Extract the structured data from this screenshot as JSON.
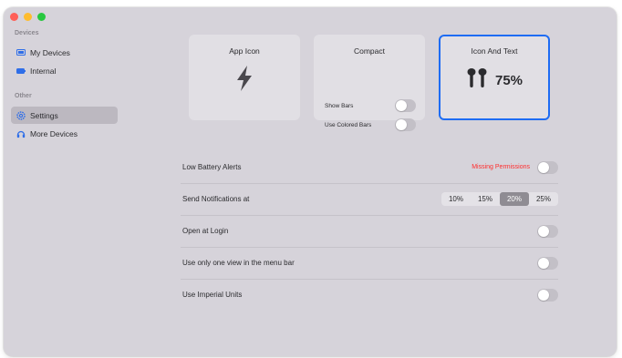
{
  "sidebar": {
    "sections": [
      {
        "title": "Devices",
        "items": [
          {
            "label": "My Devices",
            "icon": "display-icon",
            "selected": false
          },
          {
            "label": "Internal",
            "icon": "battery-icon",
            "selected": false
          }
        ]
      },
      {
        "title": "Other",
        "items": [
          {
            "label": "Settings",
            "icon": "gear-icon",
            "selected": true
          },
          {
            "label": "More Devices",
            "icon": "headphones-icon",
            "selected": false
          }
        ]
      }
    ]
  },
  "styles": {
    "cards": [
      {
        "title": "App Icon",
        "icon": "lightning-bolt-icon",
        "selected": false
      },
      {
        "title": "Compact",
        "selected": false,
        "options": [
          {
            "label": "Show Bars",
            "on": false
          },
          {
            "label": "Use Colored Bars",
            "on": false
          }
        ]
      },
      {
        "title": "Icon And Text",
        "icon": "airpods-icon",
        "value": "75%",
        "selected": true
      }
    ]
  },
  "settings": {
    "low_battery": {
      "label": "Low Battery Alerts",
      "warning": "Missing Permissions",
      "on": false
    },
    "notifications": {
      "label": "Send Notifications at",
      "options": [
        "10%",
        "15%",
        "20%",
        "25%"
      ],
      "selected": "20%"
    },
    "open_at_login": {
      "label": "Open at Login",
      "on": false
    },
    "one_view": {
      "label": "Use only one view in the menu bar",
      "on": false
    },
    "imperial": {
      "label": "Use Imperial Units",
      "on": false
    }
  },
  "colors": {
    "accent": "#1e6cf3",
    "warning": "#ff2d2d",
    "window_bg": "#d6d3da",
    "card_bg": "#e1dfe4"
  }
}
